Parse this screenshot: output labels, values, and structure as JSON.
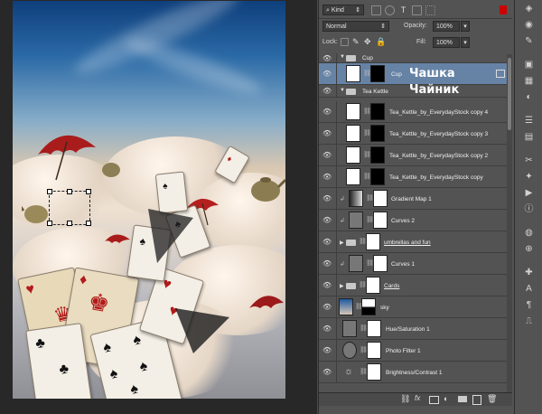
{
  "filter": {
    "kind_label": "Kind"
  },
  "blend": {
    "mode": "Normal",
    "opacity_label": "Opacity:",
    "opacity_value": "100%"
  },
  "lock": {
    "label": "Lock:",
    "fill_label": "Fill:",
    "fill_value": "100%"
  },
  "overlay": {
    "cup_ru": "Чашка",
    "kettle_ru": "Чайник"
  },
  "layers": [
    {
      "name": "Cup",
      "kind": "group"
    },
    {
      "name": "Cup",
      "kind": "layer",
      "selected": true
    },
    {
      "name": "Tea Kettle",
      "kind": "group"
    },
    {
      "name": "Tea_Kettle_by_EverydayStock copy 4",
      "kind": "layer"
    },
    {
      "name": "Tea_Kettle_by_EverydayStock copy 3",
      "kind": "layer"
    },
    {
      "name": "Tea_Kettle_by_EverydayStock copy 2",
      "kind": "layer"
    },
    {
      "name": "Tea_Kettle_by_EverydayStock copy",
      "kind": "layer"
    },
    {
      "name": "Gradient Map 1",
      "kind": "adjustment"
    },
    {
      "name": "Curves 2",
      "kind": "adjustment"
    },
    {
      "name": "umbrellas and fun",
      "kind": "group-closed"
    },
    {
      "name": "Curves 1",
      "kind": "adjustment"
    },
    {
      "name": "Cards",
      "kind": "group-closed"
    },
    {
      "name": "sky",
      "kind": "layer"
    },
    {
      "name": "Hue/Saturation 1",
      "kind": "adjustment"
    },
    {
      "name": "Photo Filter 1",
      "kind": "adjustment"
    },
    {
      "name": "Brightness/Contrast 1",
      "kind": "adjustment"
    }
  ],
  "icons": [
    "eye-icon",
    "link-icon",
    "fx-icon",
    "mask-icon",
    "new-group-icon",
    "new-layer-icon",
    "trash-icon"
  ]
}
